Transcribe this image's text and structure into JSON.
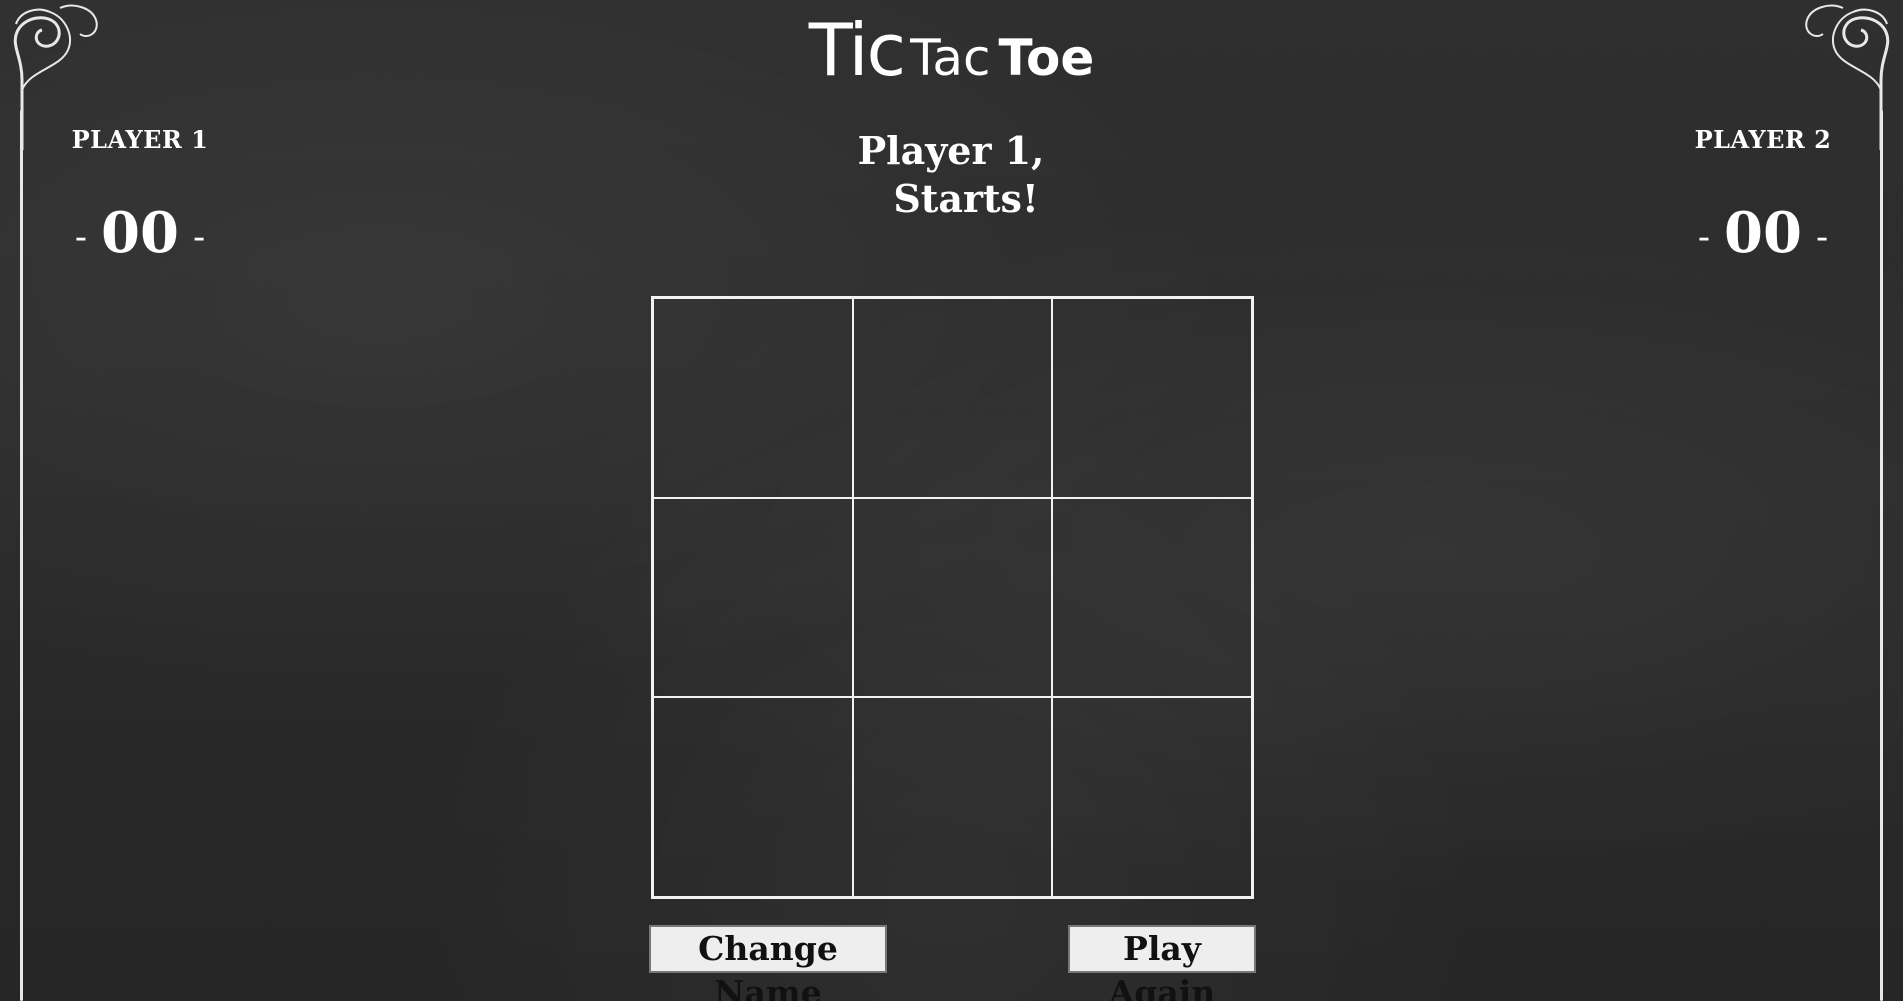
{
  "title": {
    "part1": "Tic",
    "part2": "Tac",
    "part3": "Toe"
  },
  "players": {
    "left": {
      "name": "PLAYER 1",
      "score": "00",
      "dash": "-"
    },
    "right": {
      "name": "PLAYER 2",
      "score": "00",
      "dash": "-"
    }
  },
  "status": {
    "line1": "Player 1,",
    "line2": "Starts!"
  },
  "board": {
    "cells": [
      "",
      "",
      "",
      "",
      "",
      "",
      "",
      "",
      ""
    ]
  },
  "buttons": {
    "change_name": "Change Name",
    "play_again": "Play Again"
  },
  "colors": {
    "background": "#2b2b2b",
    "chalk": "#f2f2f2",
    "button_bg": "#eeeeee"
  }
}
